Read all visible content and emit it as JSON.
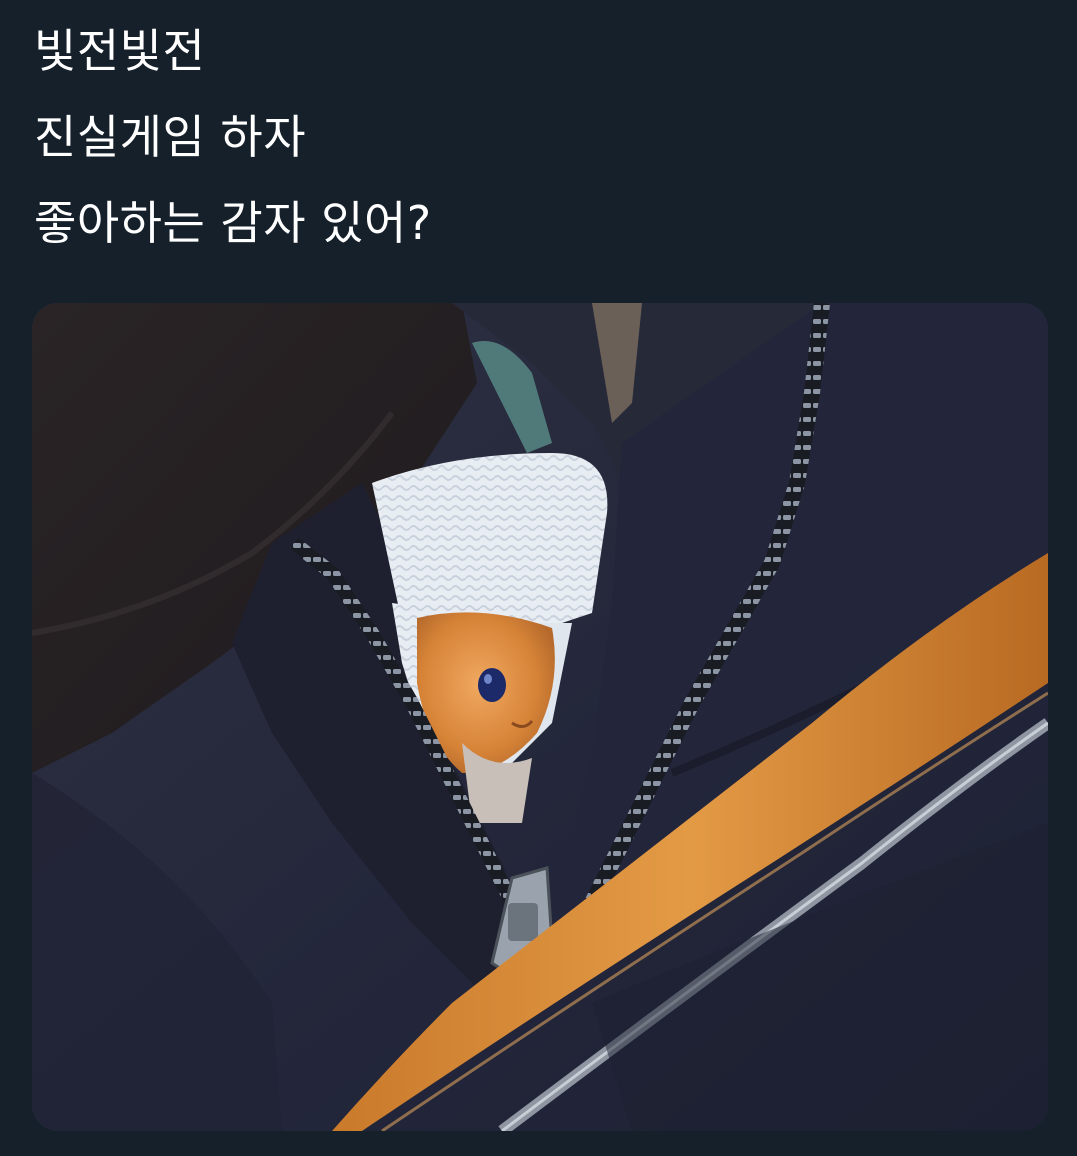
{
  "tweet": {
    "lines": [
      "빛전빛전",
      "진실게임 하자",
      "좋아하는 감자 있어?"
    ]
  },
  "media": {
    "subject-icon": "hamster-in-jacket-photo"
  },
  "colors": {
    "background": "#15202b",
    "text": "#ffffff"
  }
}
